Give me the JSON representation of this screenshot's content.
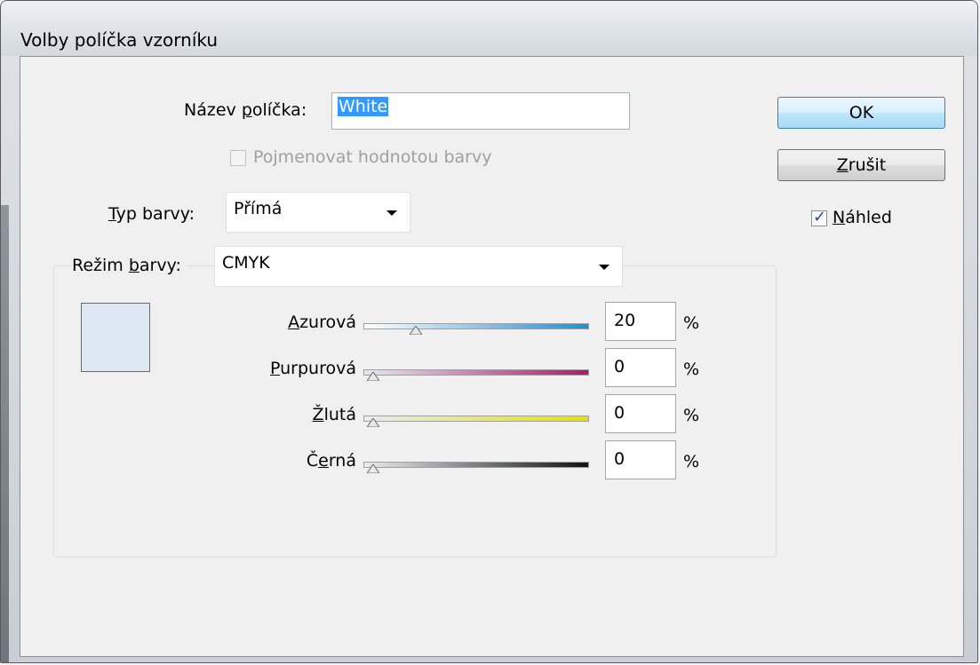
{
  "window": {
    "title": "Volby políčka vzorníku"
  },
  "swatch_name": {
    "label_prefix": "Název ",
    "label_mnemonic": "p",
    "label_rest": "olíčka:",
    "value": "White"
  },
  "name_with_value": {
    "label": "Pojmenovat hodnotou barvy",
    "checked": false,
    "disabled": true
  },
  "color_type": {
    "label_mnemonic": "T",
    "label_rest": "yp barvy:",
    "value": "Přímá"
  },
  "color_mode": {
    "label_prefix": "Režim ",
    "label_mnemonic": "b",
    "label_rest": "arvy:",
    "value": "CMYK"
  },
  "swatch_preview_color": "#dde8f4",
  "channels": [
    {
      "label_mnemonic": "A",
      "label_rest": "zurová",
      "value": "20",
      "percent": "%",
      "level": 20,
      "gradient_from": "#ffffff",
      "gradient_to": "#1a8fe0"
    },
    {
      "label_mnemonic": "P",
      "label_rest": "urpurová",
      "value": "0",
      "percent": "%",
      "level": 0,
      "gradient_from": "#e6e6f0",
      "gradient_to": "#b01870"
    },
    {
      "label_mnemonic": "Ž",
      "label_rest": "lutá",
      "value": "0",
      "percent": "%",
      "level": 0,
      "gradient_from": "#e6eef0",
      "gradient_to": "#e8e000"
    },
    {
      "label_prefix": "Č",
      "label_mnemonic": "e",
      "label_rest": "rná",
      "value": "0",
      "percent": "%",
      "level": 0,
      "gradient_from": "#e8eef0",
      "gradient_to": "#111111"
    }
  ],
  "buttons": {
    "ok": "OK",
    "cancel_mnemonic": "Z",
    "cancel_rest": "rušit"
  },
  "preview": {
    "label_mnemonic": "N",
    "label_rest": "áhled",
    "checked": true
  }
}
